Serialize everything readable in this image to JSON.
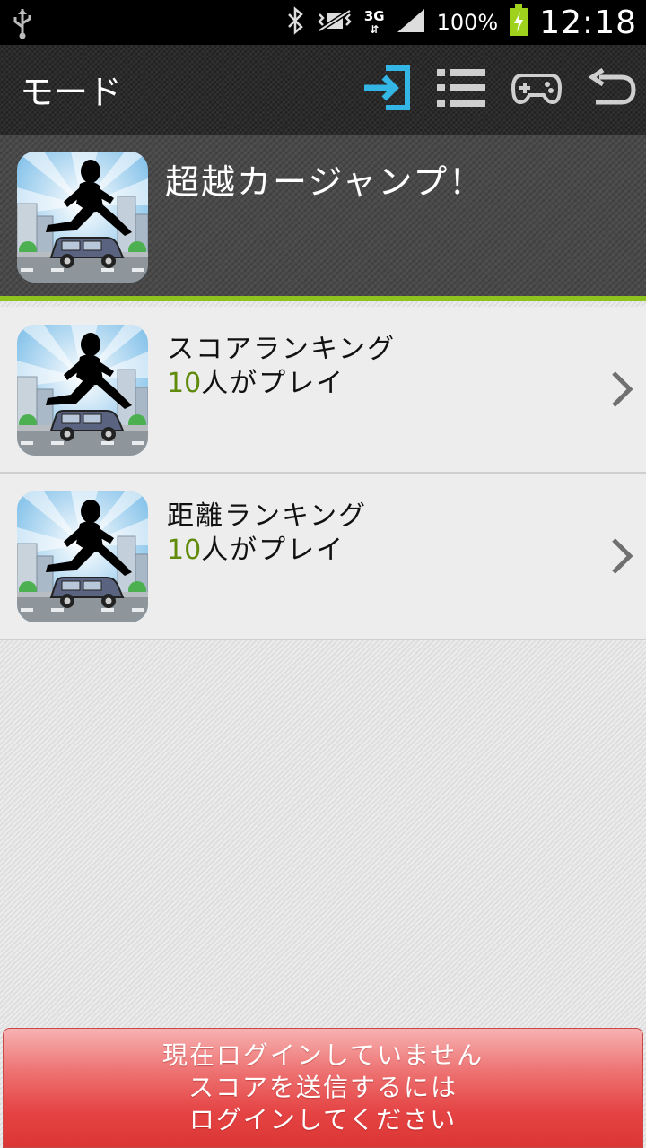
{
  "status_bar": {
    "network": "3G",
    "battery_percent": "100%",
    "clock": "12:18"
  },
  "action_bar": {
    "title": "モード",
    "icons": [
      "login-icon",
      "list-icon",
      "gamepad-icon",
      "back-icon"
    ],
    "active_color": "#33b5e5"
  },
  "game": {
    "title": "超越カージャンプ！"
  },
  "rankings": [
    {
      "label": "スコアランキング",
      "player_count": "10",
      "player_suffix": "人がプレイ"
    },
    {
      "label": "距離ランキング",
      "player_count": "10",
      "player_suffix": "人がプレイ"
    }
  ],
  "login_banner": {
    "lines": [
      "現在ログインしていません",
      "スコアを送信するには",
      "ログインしてください"
    ]
  },
  "colors": {
    "accent_green": "#8dc21f",
    "count_green": "#5f8a0a",
    "banner_red": "#e54444"
  }
}
